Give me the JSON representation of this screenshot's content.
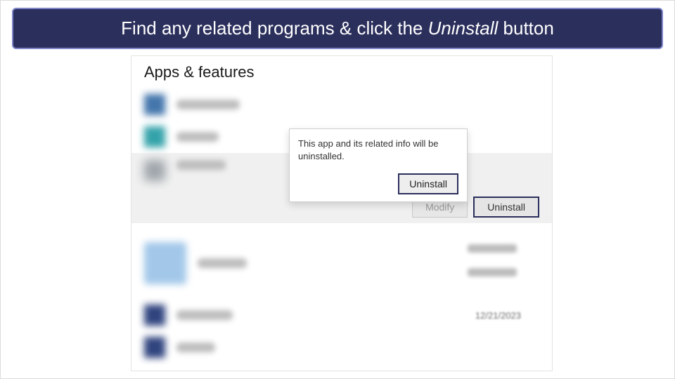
{
  "banner": {
    "prefix": "Find any related programs & click the ",
    "emphasis": "Uninstall",
    "suffix": " button"
  },
  "page": {
    "title": "Apps & features"
  },
  "selected_app": {
    "modify_label": "Modify",
    "uninstall_label": "Uninstall"
  },
  "flyout": {
    "message": "This app and its related info will be uninstalled.",
    "confirm_label": "Uninstall"
  },
  "visible_date": "12/21/2023"
}
